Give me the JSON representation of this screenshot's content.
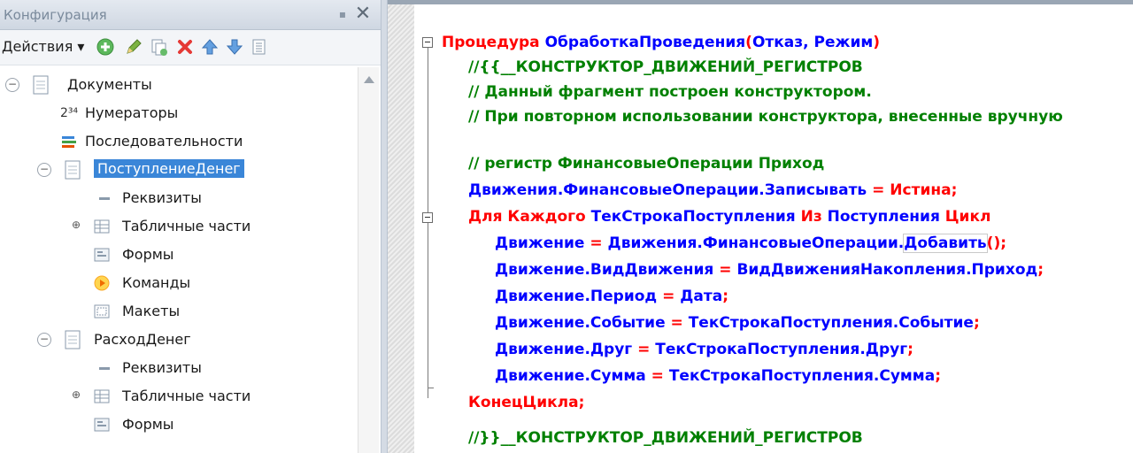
{
  "panel": {
    "title": "Конфигурация",
    "actions_label": "Действия ▾"
  },
  "tree": [
    {
      "label": "Документы",
      "toggle": "⊖"
    },
    {
      "label": "Нумераторы"
    },
    {
      "label": "Последовательности"
    },
    {
      "label": "ПоступлениеДенег",
      "toggle": "⊖",
      "selected": true
    },
    {
      "label": "Реквизиты"
    },
    {
      "label": "Табличные части",
      "toggle": "⊕"
    },
    {
      "label": "Формы"
    },
    {
      "label": "Команды"
    },
    {
      "label": "Макеты"
    },
    {
      "label": "РасходДенег",
      "toggle": "⊖"
    },
    {
      "label": "Реквизиты"
    },
    {
      "label": "Табличные части",
      "toggle": "⊕"
    },
    {
      "label": "Формы"
    }
  ],
  "code": {
    "line1": {
      "kw": "Процедура ",
      "name": "ОбработкаПроведения",
      "p1": "(",
      "a1": "Отказ",
      "c1": ", ",
      "a2": "Режим",
      "p2": ")"
    },
    "line2": "//{{__КОНСТРУКТОР_ДВИЖЕНИЙ_РЕГИСТРОВ",
    "line3": "// Данный фрагмент построен конструктором.",
    "line4": "// При повторном использовании конструктора, внесенные вручную",
    "line5": "// регистр ФинансовыеОперации Приход",
    "line6": {
      "a": "Движения.ФинансовыеОперации.Записывать",
      "op": " = ",
      "kw": "Истина",
      "end": ";"
    },
    "line7": {
      "kw1": "Для Каждого ",
      "v": "ТекСтрокаПоступления",
      "kw2": " Из ",
      "c": "Поступления",
      "kw3": " Цикл"
    },
    "line8": {
      "a": "Движение",
      "op": " = ",
      "b": "Движения.ФинансовыеОперации.",
      "m": "Добавить",
      "end": "();"
    },
    "line9": {
      "a": "Движение.ВидДвижения",
      "op": " = ",
      "b": "ВидДвиженияНакопления.Приход",
      "end": ";"
    },
    "line10": {
      "a": "Движение.Период",
      "op": " = ",
      "b": "Дата",
      "end": ";"
    },
    "line11": {
      "a": "Движение.Событие",
      "op": " = ",
      "b": "ТекСтрокаПоступления.Событие",
      "end": ";"
    },
    "line12": {
      "a": "Движение.Друг",
      "op": " = ",
      "b": "ТекСтрокаПоступления.Друг",
      "end": ";"
    },
    "line13": {
      "a": "Движение.Сумма",
      "op": " = ",
      "b": "ТекСтрокаПоступления.Сумма",
      "end": ";"
    },
    "line14": "КонецЦикла;",
    "line15": "//}}__КОНСТРУКТОР_ДВИЖЕНИЙ_РЕГИСТРОВ"
  },
  "colors": {
    "keyword": "#ff0000",
    "identifier": "#0000ff",
    "comment": "#008000",
    "selection": "#3a86d8"
  }
}
